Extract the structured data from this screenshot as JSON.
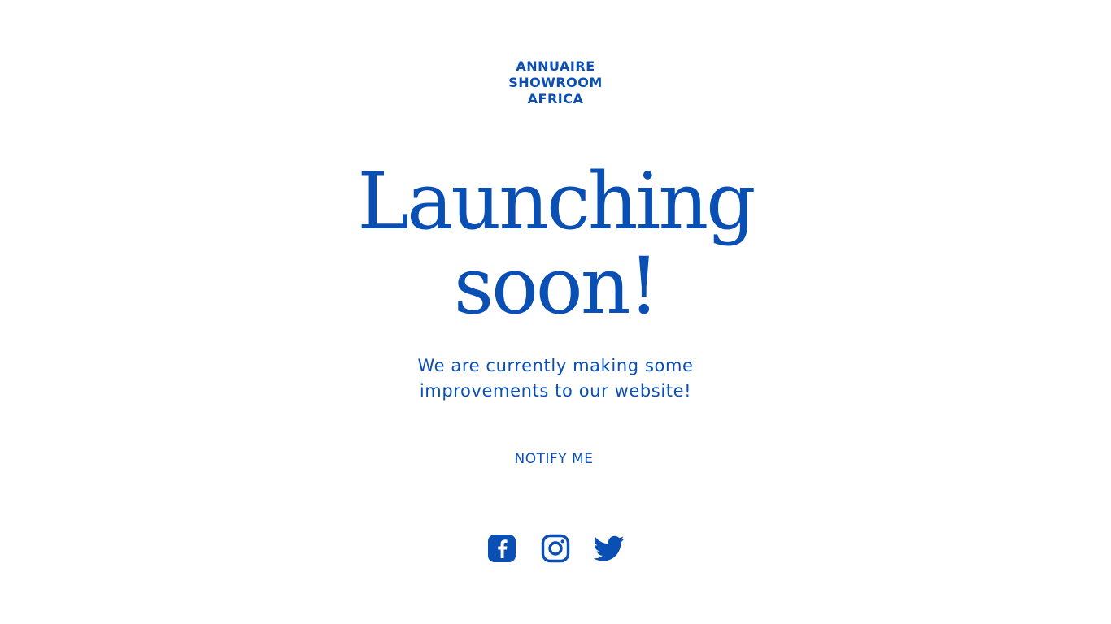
{
  "logo": {
    "line1": "ANNUAIRE",
    "line2": "SHOWROOM",
    "line3": "AFRICA"
  },
  "headline": {
    "line1": "Launching",
    "line2": "soon!"
  },
  "subtitle": {
    "line1": "We are currently making some",
    "line2": "improvements to our website!"
  },
  "cta": {
    "notify_label": "NOTIFY ME"
  },
  "social": {
    "icons": [
      "facebook-icon",
      "instagram-icon",
      "twitter-icon"
    ]
  },
  "colors": {
    "brand": "#0a4fb4",
    "background": "#ffffff"
  }
}
